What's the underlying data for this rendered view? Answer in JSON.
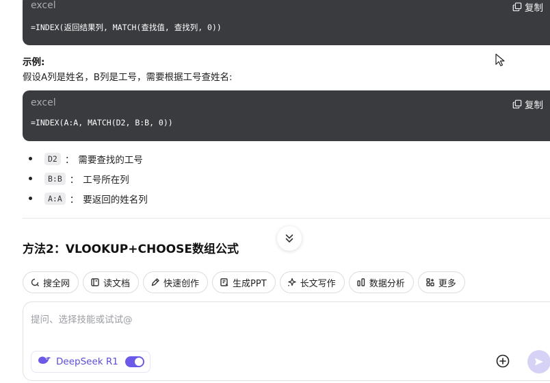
{
  "code_blocks": [
    {
      "language": "excel",
      "copy_label": "复制",
      "code": "=INDEX(返回结果列, MATCH(查找值, 查找列, 0))"
    },
    {
      "language": "excel",
      "copy_label": "复制",
      "code": "=INDEX(A:A, MATCH(D2, B:B, 0))"
    }
  ],
  "example": {
    "title": "示例:",
    "description": "假设A列是姓名，B列是工号，需要根据工号查姓名:"
  },
  "bullets": [
    {
      "code": "D2",
      "sep": "：",
      "text": "需要查找的工号"
    },
    {
      "code": "B:B",
      "sep": "：",
      "text": "工号所在列"
    },
    {
      "code": "A:A",
      "sep": "：",
      "text": "要返回的姓名列"
    }
  ],
  "section_title": "方法2：VLOOKUP+CHOOSE数组公式",
  "skills": [
    {
      "label": "搜全网",
      "icon": "search-icon"
    },
    {
      "label": "读文档",
      "icon": "book-icon"
    },
    {
      "label": "快速创作",
      "icon": "pen-icon"
    },
    {
      "label": "生成PPT",
      "icon": "ppt-icon"
    },
    {
      "label": "长文写作",
      "icon": "sparkle-icon"
    },
    {
      "label": "数据分析",
      "icon": "chart-icon"
    },
    {
      "label": "更多",
      "icon": "grid-icon"
    }
  ],
  "input": {
    "placeholder": "提问、选择技能或试试@",
    "value": ""
  },
  "model": {
    "label": "DeepSeek R1",
    "toggle_on": true,
    "accent": "#6b5ae8"
  }
}
